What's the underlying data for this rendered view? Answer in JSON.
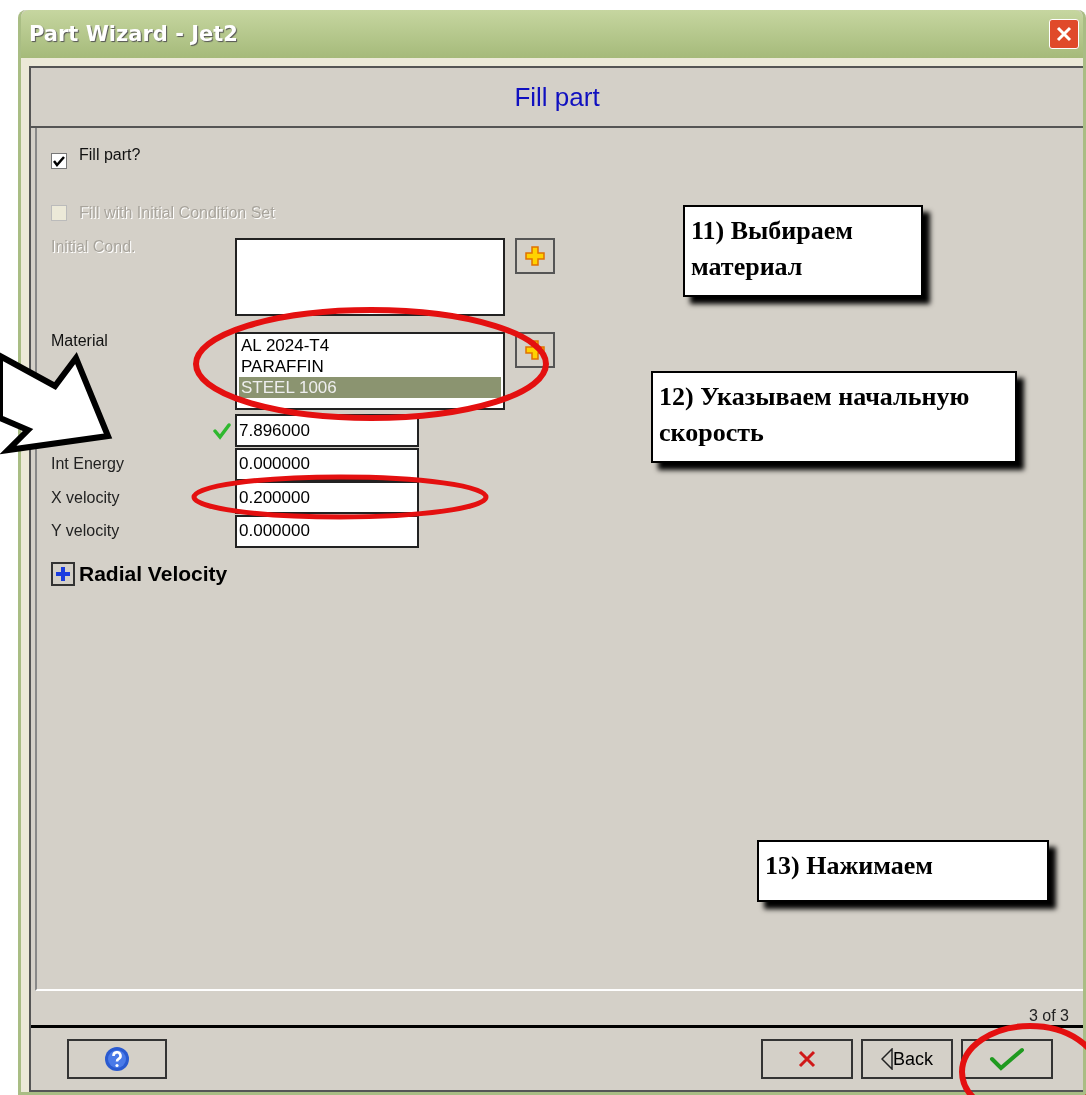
{
  "window": {
    "title": "Part Wizard - Jet2"
  },
  "header": {
    "title": "Fill part"
  },
  "fill_part": {
    "label": "Fill part?",
    "checked": true,
    "disabled": false
  },
  "fill_with_ic_set": {
    "label": "Fill with Initial Condition Set",
    "checked": false,
    "disabled": true
  },
  "initial_cond": {
    "label": "Initial Cond.",
    "disabled": true
  },
  "material": {
    "label": "Material",
    "items": [
      {
        "label": "AL 2024-T4",
        "selected": false
      },
      {
        "label": "PARAFFIN",
        "selected": false
      },
      {
        "label": "STEEL 1006",
        "selected": true
      }
    ]
  },
  "fields": [
    {
      "value": "7.896000",
      "valid": true
    },
    {
      "label": "Int Energy",
      "value": "0.000000",
      "valid": false
    },
    {
      "label": "X velocity",
      "value": "0.200000",
      "valid": false
    },
    {
      "label": "Y velocity",
      "value": "0.000000",
      "valid": false
    }
  ],
  "radial_velocity": {
    "label": "Radial Velocity",
    "expanded": false
  },
  "page_indicator": "3 of 3",
  "buttons": [
    {
      "kind": "help"
    },
    {
      "kind": "cancel"
    },
    {
      "kind": "back",
      "label": "Back"
    },
    {
      "kind": "finish"
    }
  ],
  "callouts": [
    {
      "text": "11) Выбираем материал"
    },
    {
      "text": "12) Указываем начальную скорость"
    },
    {
      "text": "13) Нажимаем"
    }
  ]
}
